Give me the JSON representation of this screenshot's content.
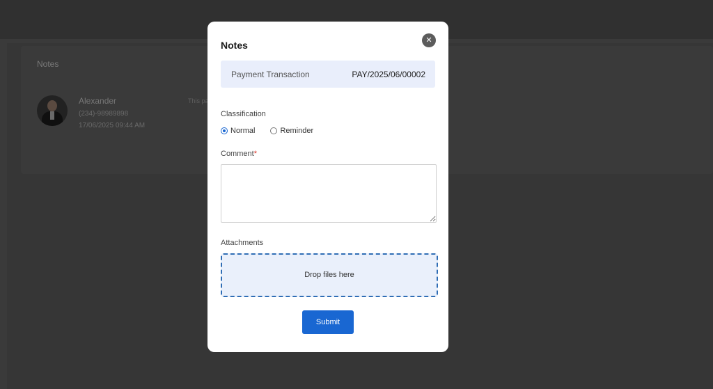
{
  "background": {
    "section_title": "Notes",
    "note": {
      "author": "Alexander",
      "phone": "(234)-98989898",
      "timestamp": "17/06/2025 09:44 AM",
      "snippet": "This pa"
    }
  },
  "modal": {
    "title": "Notes",
    "close_icon": "close-icon",
    "reference": {
      "label": "Payment Transaction",
      "value": "PAY/2025/06/00002"
    },
    "classification": {
      "label": "Classification",
      "options": [
        "Normal",
        "Reminder"
      ],
      "selected": "Normal"
    },
    "comment": {
      "label": "Comment",
      "required_mark": "*",
      "value": ""
    },
    "attachments": {
      "label": "Attachments",
      "dropzone_text": "Drop files here"
    },
    "submit_label": "Submit"
  },
  "colors": {
    "accent": "#1967d2",
    "reference_bg": "#e9eefb",
    "dropzone_border": "#2f6db5",
    "required": "#d93025",
    "overlay": "#3a3a3a"
  }
}
